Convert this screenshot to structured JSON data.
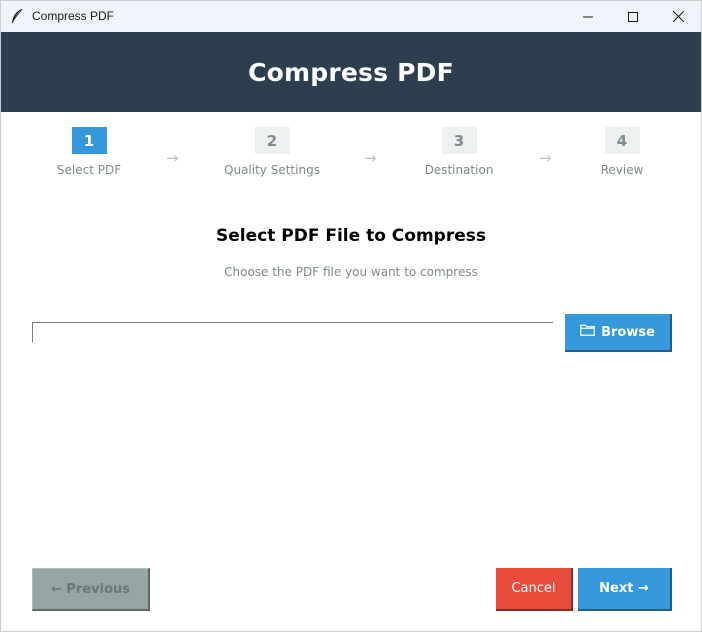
{
  "window": {
    "title": "Compress PDF",
    "icon": "feather-icon",
    "controls": [
      "minimize-icon",
      "maximize-icon",
      "close-icon"
    ]
  },
  "header": {
    "title": "Compress PDF",
    "background": "#2c3e50"
  },
  "steps": [
    {
      "number": "1",
      "label": "Select PDF",
      "active": true
    },
    {
      "number": "2",
      "label": "Quality Settings",
      "active": false
    },
    {
      "number": "3",
      "label": "Destination",
      "active": false
    },
    {
      "number": "4",
      "label": "Review",
      "active": false
    }
  ],
  "step_arrow": "→",
  "content": {
    "title": "Select PDF File to Compress",
    "subtitle": "Choose the PDF file you want to compress",
    "file_path_value": "",
    "browse_label": "Browse",
    "browse_icon": "folder-icon"
  },
  "footer": {
    "previous_label": "← Previous",
    "cancel_label": "Cancel",
    "next_label": "Next →"
  },
  "colors": {
    "accent": "#3498db",
    "danger": "#e74c3c",
    "disabled": "#95a5a6",
    "muted_text": "#7f8c8d"
  }
}
